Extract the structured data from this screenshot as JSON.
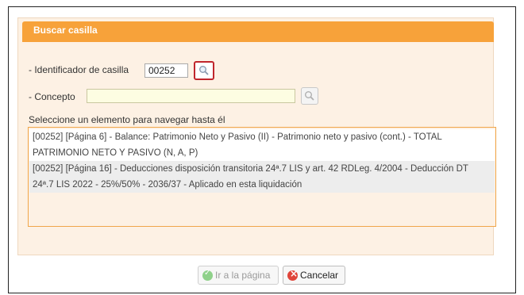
{
  "panel": {
    "title": "Buscar casilla"
  },
  "id_field": {
    "label": "- Identificador de casilla",
    "value": "00252"
  },
  "concept_field": {
    "label": "- Concepto",
    "value": ""
  },
  "results": {
    "label": "Seleccione un elemento para navegar hasta él",
    "items": [
      {
        "text": "[00252] [Página 6] - Balance: Patrimonio Neto y Pasivo (II) - Patrimonio neto y pasivo (cont.) - TOTAL PATRIMONIO NETO Y PASIVO (N, A, P)"
      },
      {
        "text": "[00252] [Página 16] - Deducciones disposición transitoria 24ª.7 LIS y art. 42 RDLeg. 4/2004 - Deducción DT 24ª.7 LIS 2022 - 25%/50% - 2036/37 - Aplicado en esta liquidación"
      }
    ]
  },
  "buttons": {
    "go": "Ir a la página",
    "cancel": "Cancelar"
  },
  "icons": {
    "search": "magnifier-icon",
    "go": "check-circle-icon",
    "cancel": "close-circle-icon"
  },
  "colors": {
    "header": "#f7a23a",
    "panel_bg": "#fdf1e4",
    "highlight": "#c0262c"
  }
}
